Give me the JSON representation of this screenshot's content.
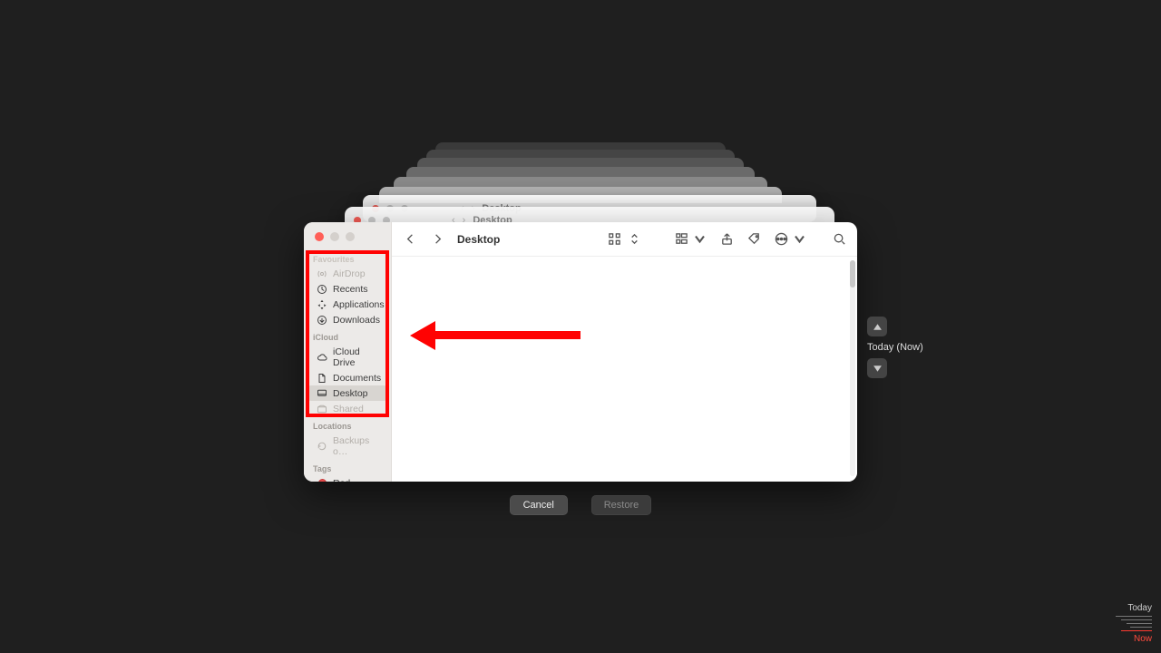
{
  "window": {
    "title": "Desktop"
  },
  "sidebar": {
    "sections": [
      {
        "heading": "Favourites",
        "items": [
          {
            "label": "AirDrop",
            "icon": "airdrop",
            "dim": true
          },
          {
            "label": "Recents",
            "icon": "clock"
          },
          {
            "label": "Applications",
            "icon": "apps"
          },
          {
            "label": "Downloads",
            "icon": "download"
          }
        ]
      },
      {
        "heading": "iCloud",
        "items": [
          {
            "label": "iCloud Drive",
            "icon": "cloud"
          },
          {
            "label": "Documents",
            "icon": "doc"
          },
          {
            "label": "Desktop",
            "icon": "desktop",
            "selected": true
          },
          {
            "label": "Shared",
            "icon": "shared",
            "dim": true
          }
        ]
      },
      {
        "heading": "Locations",
        "items": [
          {
            "label": "Backups o…",
            "icon": "timemachine",
            "dim": true
          }
        ]
      },
      {
        "heading": "Tags",
        "items": [
          {
            "label": "Red",
            "icon": "tag-red"
          }
        ]
      }
    ]
  },
  "buttons": {
    "cancel": "Cancel",
    "restore": "Restore"
  },
  "time_nav": {
    "label": "Today (Now)"
  },
  "timeline": {
    "top": "Today",
    "now": "Now"
  }
}
